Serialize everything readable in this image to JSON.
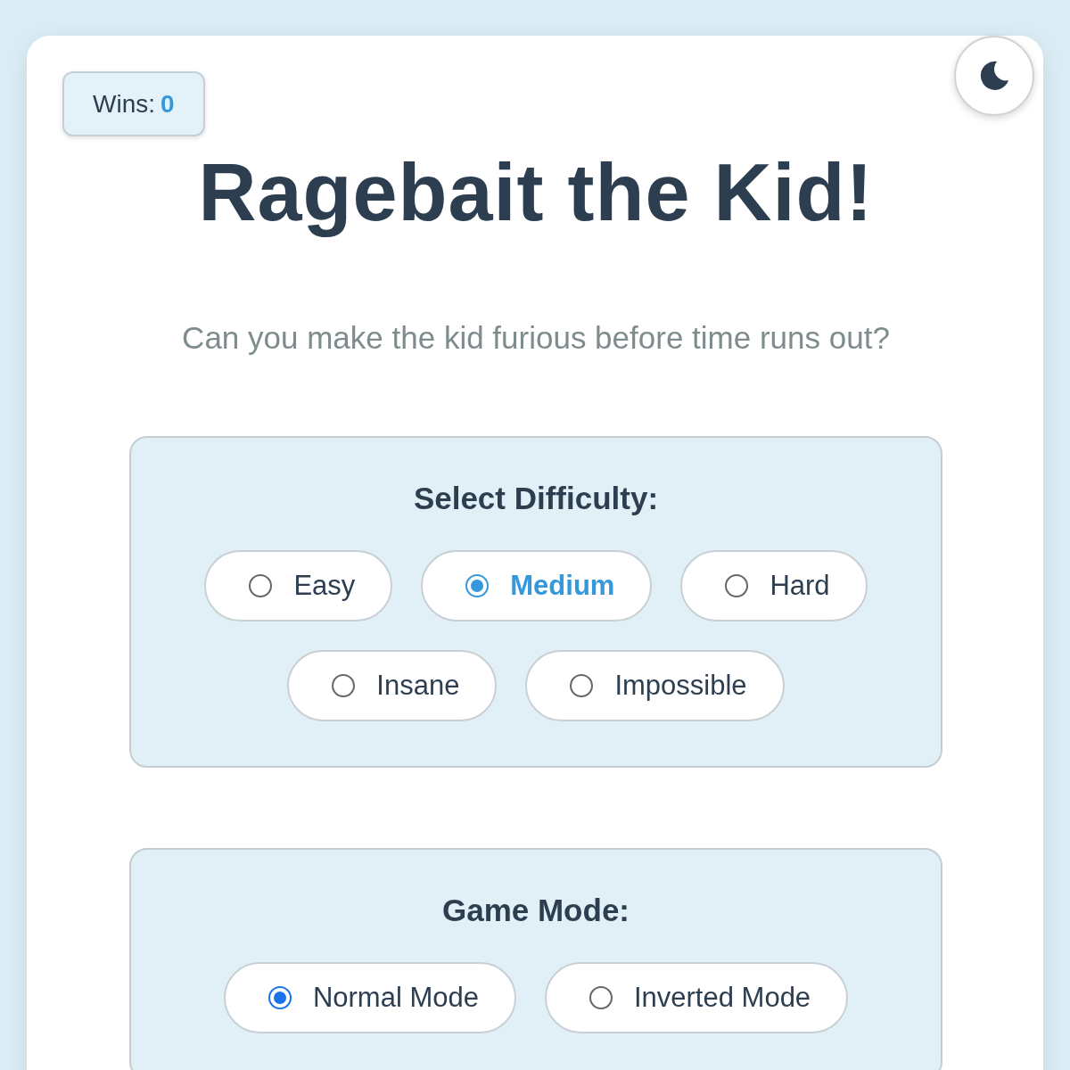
{
  "wins": {
    "label": "Wins:",
    "value": "0"
  },
  "theme_toggle": {
    "dark_mode": false
  },
  "title": "Ragebait the Kid!",
  "subtitle": "Can you make the kid furious before time runs out?",
  "difficulty": {
    "heading": "Select Difficulty:",
    "options": [
      {
        "label": "Easy",
        "selected": false
      },
      {
        "label": "Medium",
        "selected": true
      },
      {
        "label": "Hard",
        "selected": false
      },
      {
        "label": "Insane",
        "selected": false
      },
      {
        "label": "Impossible",
        "selected": false
      }
    ]
  },
  "game_mode": {
    "heading": "Game Mode:",
    "options": [
      {
        "label": "Normal Mode",
        "selected": true
      },
      {
        "label": "Inverted Mode",
        "selected": false
      }
    ]
  }
}
